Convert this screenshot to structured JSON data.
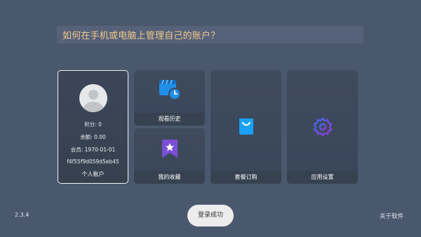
{
  "question": "如何在手机或电脑上管理自己的账户？",
  "account": {
    "points": "积分: 0",
    "balance": "余额: 0.00",
    "member": "会员: 1970-01-01",
    "device_id": "f4f55f9d059d5eb45",
    "label": "个人账户"
  },
  "tiles": {
    "history": "观看历史",
    "favorites": "我的收藏",
    "subscription": "套餐订购",
    "settings": "应用设置"
  },
  "toast": "登录成功",
  "version": "2.3.4",
  "about": "关于软件",
  "colors": {
    "background": "#4a586e",
    "question_text": "#f3c88a",
    "history_icon": "#1f8fe8",
    "favorites_icon": "#7a4fd6",
    "subscription_icon": "#1aa0f5",
    "settings_icon": "#5a4ee0"
  }
}
